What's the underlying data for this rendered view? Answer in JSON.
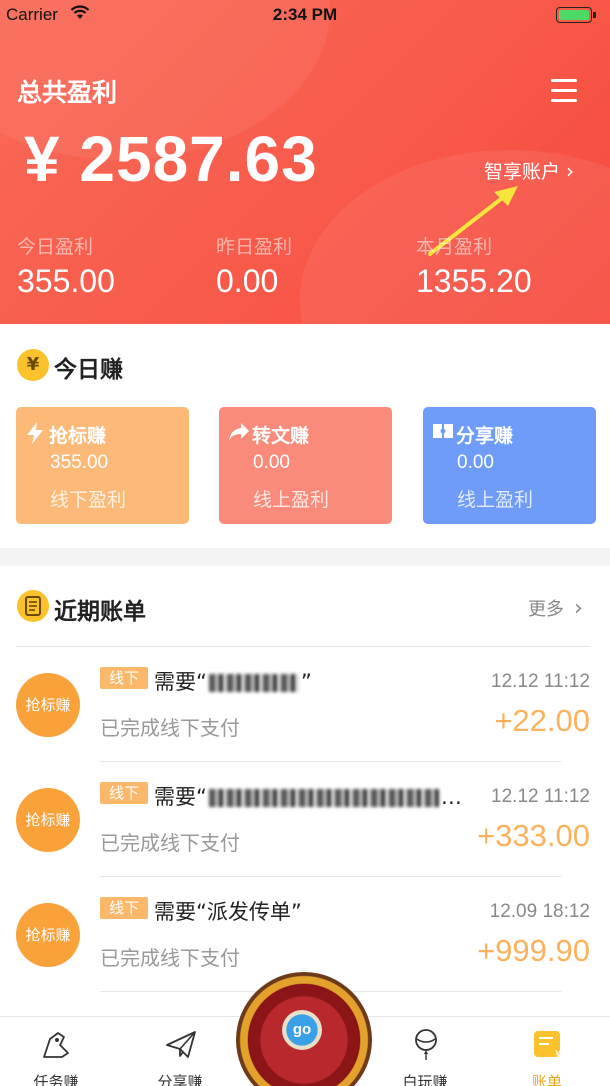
{
  "status_bar": {
    "carrier": "Carrier",
    "time": "2:34 PM"
  },
  "header": {
    "total_label": "总共盈利",
    "total_amount": "¥ 2587.63",
    "smart_account_label": "智享账户",
    "stats": [
      {
        "label": "今日盈利",
        "value": "355.00"
      },
      {
        "label": "昨日盈利",
        "value": "0.00"
      },
      {
        "label": "本月盈利",
        "value": "1355.20"
      }
    ]
  },
  "today": {
    "coin_glyph": "¥",
    "title": "今日赚",
    "cards": [
      {
        "title": "抢标赚",
        "value": "355.00",
        "subtitle": "线下盈利",
        "color": "#fcb977"
      },
      {
        "title": "转文赚",
        "value": "0.00",
        "subtitle": "线上盈利",
        "color": "#fa8a7a"
      },
      {
        "title": "分享赚",
        "value": "0.00",
        "subtitle": "线上盈利",
        "color": "#6f9cf8"
      }
    ]
  },
  "recent": {
    "title": "近期账单",
    "more_label": "更多",
    "bills": [
      {
        "badge": "抢标赚",
        "tag": "线下",
        "title_prefix": "需要“",
        "title_suffix": "”",
        "time": "12.12 11:12",
        "status": "已完成线下支付",
        "amount": "+22.00"
      },
      {
        "badge": "抢标赚",
        "tag": "线下",
        "title_prefix": "需要“",
        "title_suffix": "…",
        "time": "12.12 11:12",
        "status": "已完成线下支付",
        "amount": "+333.00"
      },
      {
        "badge": "抢标赚",
        "tag": "线下",
        "title_prefix": "需要“派发传单”",
        "title_suffix": "",
        "time": "12.09 18:12",
        "status": "已完成线下支付",
        "amount": "+999.90"
      }
    ]
  },
  "tabbar": {
    "tabs": [
      {
        "label": "任务赚",
        "icon": "task-icon",
        "active": false
      },
      {
        "label": "分享赚",
        "icon": "paper-plane-icon",
        "active": false
      },
      {
        "label": "白玩赚",
        "icon": "balloon-icon",
        "active": false
      },
      {
        "label": "账单",
        "icon": "bill-icon",
        "active": true
      }
    ],
    "center_button_label": "go"
  },
  "colors": {
    "header": "#f85a4a",
    "accent": "#fcb25c",
    "active_tab": "#f3a51a"
  }
}
